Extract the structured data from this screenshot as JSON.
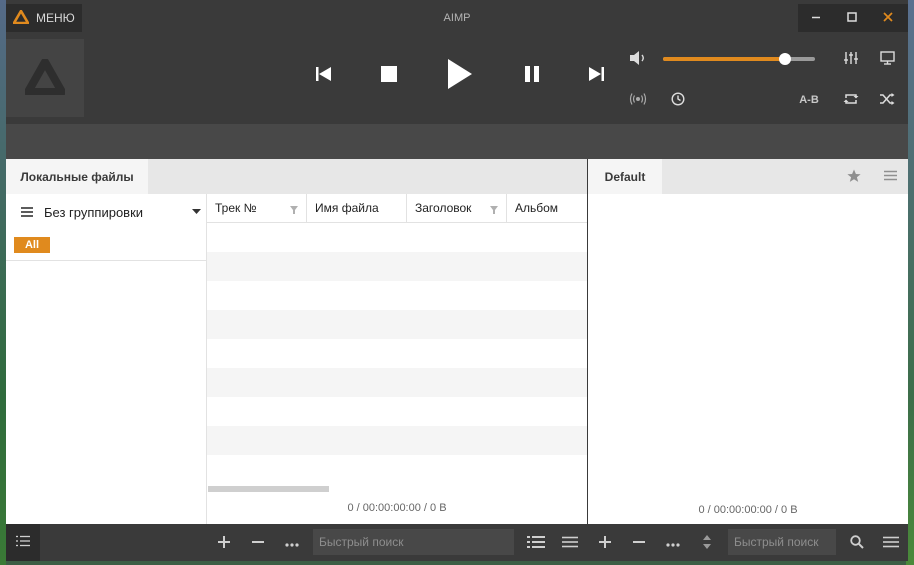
{
  "window": {
    "title": "AIMP",
    "menu_label": "МЕНЮ"
  },
  "player": {
    "volume_percent": 80,
    "ab_label": "A-B"
  },
  "left_panel": {
    "tab_label": "Локальные файлы",
    "grouping_label": "Без группировки",
    "filter_tag": "All",
    "columns": [
      "Трек №",
      "Имя файла",
      "Заголовок",
      "Альбом"
    ],
    "status": "0 / 00:00:00:00 / 0 B"
  },
  "right_panel": {
    "tab_label": "Default",
    "status": "0 / 00:00:00:00 / 0 B"
  },
  "bottom": {
    "search_placeholder_left": "Быстрый поиск",
    "search_placeholder_right": "Быстрый поиск"
  },
  "colors": {
    "accent": "#e08a1e",
    "background": "#3a3a3a"
  }
}
